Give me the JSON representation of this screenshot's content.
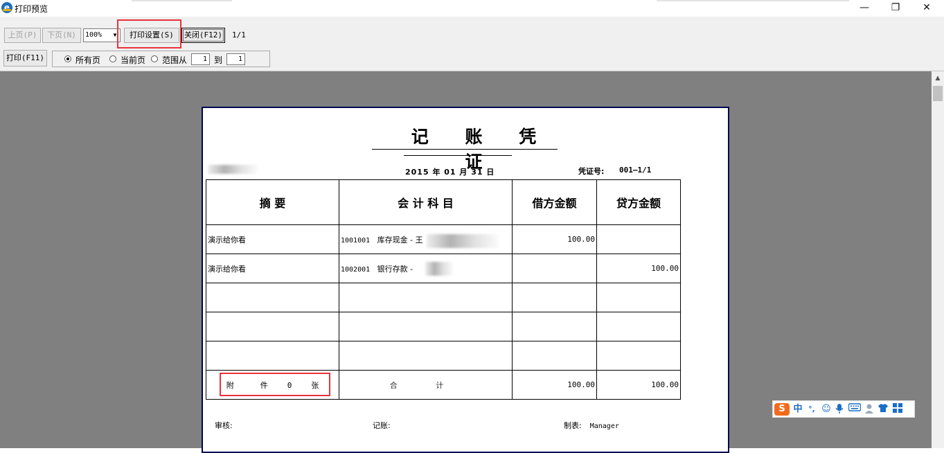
{
  "window": {
    "title": "打印预览",
    "controls": {
      "minimize": "—",
      "restore": "❐",
      "close": "✕"
    }
  },
  "toolbar": {
    "prev_page": "上页(P)",
    "next_page": "下页(N)",
    "zoom_value": "100%",
    "print_settings": "打印设置(S)",
    "close": "关闭(F12)",
    "page_count": "1/1",
    "print": "打印(F11)",
    "range": {
      "all_pages": "所有页",
      "current_page": "当前页",
      "range_from": "范围从",
      "to": "到",
      "from_value": "1",
      "to_value": "1",
      "selected": "all_pages"
    }
  },
  "voucher": {
    "title": "记 账 凭 证",
    "date": "2015 年 01 月 31 日",
    "number_label": "凭证号:",
    "number": "001—1/1",
    "headers": [
      "摘   要",
      "会 计 科 目",
      "借方金额",
      "贷方金额"
    ],
    "rows": [
      {
        "summary": "演示给你看",
        "account_code": "1001001",
        "account_name": "库存现金 - 王",
        "debit": "100.00",
        "credit": ""
      },
      {
        "summary": "演示给你看",
        "account_code": "1002001",
        "account_name": "银行存款 -",
        "debit": "",
        "credit": "100.00"
      },
      {
        "summary": "",
        "account_code": "",
        "account_name": "",
        "debit": "",
        "credit": ""
      },
      {
        "summary": "",
        "account_code": "",
        "account_name": "",
        "debit": "",
        "credit": ""
      },
      {
        "summary": "",
        "account_code": "",
        "account_name": "",
        "debit": "",
        "credit": ""
      }
    ],
    "attachments": {
      "prefix": "附",
      "mid": "件",
      "count": "0",
      "suffix": "张"
    },
    "total_label": "合 计",
    "total_debit": "100.00",
    "total_credit": "100.00",
    "signatures": {
      "review_label": "审核:",
      "bookkeeping_label": "记账:",
      "preparer_label": "制表:",
      "preparer": "Manager"
    }
  },
  "ime": {
    "logo": "S",
    "mode": "中",
    "punct": "°,",
    "icons": [
      "smiley-icon",
      "microphone-icon",
      "keyboard-icon",
      "user-icon",
      "shirt-icon",
      "grid-icon"
    ]
  },
  "colors": {
    "highlight_box": "#e8323c",
    "preview_bg": "#808080",
    "paper_border": "#000050",
    "ime_logo": "#f26b1d",
    "ime_blue": "#1a6dc7"
  }
}
